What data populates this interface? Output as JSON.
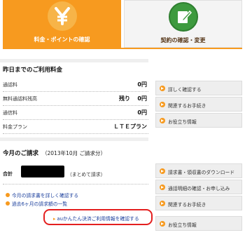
{
  "tabs": [
    {
      "label": "料金・ポイントの確認",
      "icon": "yen-icon",
      "active": true
    },
    {
      "label": "契約の確認・変更",
      "icon": "edit-document-icon",
      "active": false
    }
  ],
  "usage": {
    "title": "昨日までのご利用料金",
    "rows": [
      {
        "label": "通話料",
        "value": "0円"
      },
      {
        "label": "無料通話料残高",
        "remaining_label": "残り",
        "value": "0円"
      },
      {
        "label": "通信料",
        "value": "0円"
      },
      {
        "label": "料金プラン",
        "value": "ＬＴＥプラン"
      }
    ]
  },
  "usage_buttons": [
    {
      "label": "詳しく確認する"
    },
    {
      "label": "関連するお手続き"
    },
    {
      "label": "お役立ち情報"
    }
  ],
  "invoice": {
    "title": "今月のご請求",
    "period": "（2013年10月 ご請求分）",
    "total_label": "合計",
    "total_note": "（まとめて請求）",
    "links": [
      {
        "label": "今月の請求書を詳しく確認する"
      },
      {
        "label": "過去6ヶ月の請求額の一覧"
      }
    ],
    "highlight_link": "auかんたん決済ご利用情報を確認する"
  },
  "invoice_buttons": [
    {
      "label": "請求書・領収書のダウンロード"
    },
    {
      "label": "通話明細の確認・お申し込み"
    },
    {
      "label": "関連するお手続き"
    },
    {
      "label": "お役立ち情報"
    }
  ],
  "colors": {
    "accent": "#f79a1f",
    "green": "#3d9a3e",
    "link": "#1a3e9c",
    "highlight": "#e41f1f"
  }
}
